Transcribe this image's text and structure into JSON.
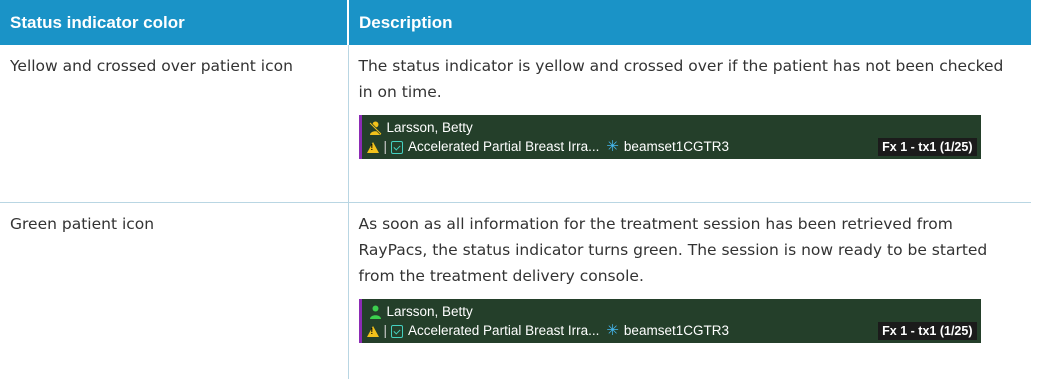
{
  "table": {
    "headers": [
      "Status indicator color",
      "Description"
    ],
    "rows": [
      {
        "color": "Yellow and crossed over patient icon",
        "description": "The status indicator is yellow and crossed over if the patient has not been checked in on time.",
        "panel": {
          "patient_name": "Larsson, Betty",
          "patient_icon": "crossed-patient-icon",
          "patient_icon_color": "#f2c21b",
          "plan_name": "Accelerated Partial Breast Irra...",
          "beamset": "beamset1CGTR3",
          "fraction": "Fx 1 - tx1 (1/25)"
        }
      },
      {
        "color": "Green patient icon",
        "description": "As soon as all information for the treatment session has been retrieved from RayPacs, the status indicator turns green. The session is now ready to be started from the treatment delivery console.",
        "panel": {
          "patient_name": "Larsson, Betty",
          "patient_icon": "patient-icon",
          "patient_icon_color": "#3ccf4e",
          "plan_name": "Accelerated Partial Breast Irra...",
          "beamset": "beamset1CGTR3",
          "fraction": "Fx 1 - tx1 (1/25)"
        }
      }
    ]
  },
  "colors": {
    "header_bg": "#1a93c7",
    "panel_bg": "#243f2a",
    "panel_accent": "#8c2bb5",
    "warning": "#f2c21b"
  }
}
